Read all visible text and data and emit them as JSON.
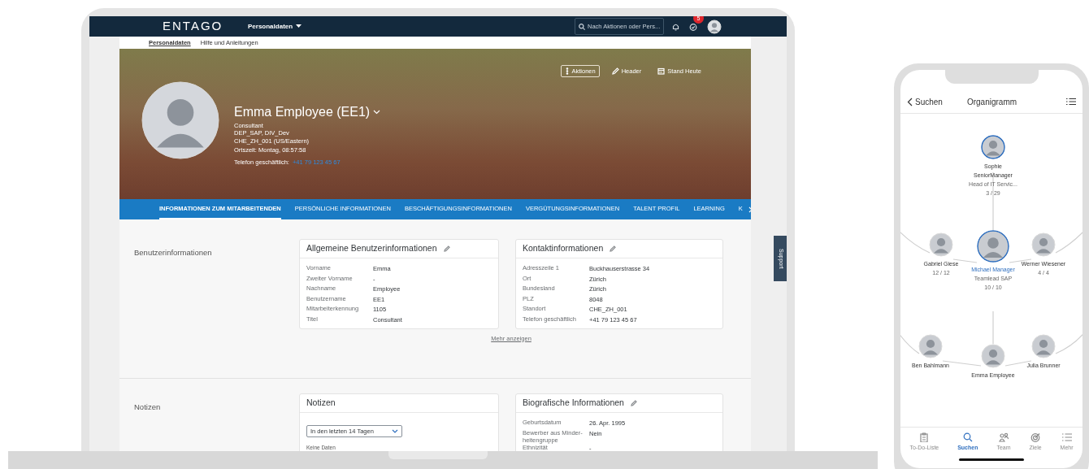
{
  "laptop": {
    "shell": {
      "logo": "ENTAGO",
      "app_menu": "Personaldaten",
      "search_placeholder": "Nach Aktionen oder Pers...",
      "notification_count": "5"
    },
    "subnav": [
      {
        "label": "Personaldaten",
        "selected": true
      },
      {
        "label": "Hilfe und Anleitungen",
        "selected": false
      }
    ],
    "profile": {
      "name": "Emma Employee (EE1)",
      "lines": [
        "Consultant",
        "DEP_SAP, DIV_Dev",
        "CHE_ZH_001 (US/Eastern)"
      ],
      "local_time": "Ortszeit: Montag, 08:57:58",
      "phone_label": "Telefon geschäftlich:",
      "phone": "+41 79 123 45 67"
    },
    "header_actions": [
      {
        "kind": "more",
        "label": "Aktionen"
      },
      {
        "kind": "edit",
        "label": "Header"
      },
      {
        "kind": "calendar",
        "label": "Stand Heute"
      }
    ],
    "tabs": [
      {
        "label": "INFORMATIONEN ZUM MITARBEITENDEN",
        "selected": true
      },
      {
        "label": "PERSÖNLICHE INFORMATIONEN",
        "selected": false
      },
      {
        "label": "BESCHÄFTIGUNGSINFORMATIONEN",
        "selected": false
      },
      {
        "label": "VERGÜTUNGSINFORMATIONEN",
        "selected": false
      },
      {
        "label": "TALENT PROFIL",
        "selected": false
      },
      {
        "label": "LEARNING",
        "selected": false
      },
      {
        "label": "K",
        "selected": false
      }
    ],
    "sections": [
      {
        "title": "Benutzerinformationen",
        "more_link": "Mehr anzeigen",
        "cards": [
          {
            "title": "Allgemeine Benutzerinformationen",
            "editable": true,
            "rows": [
              {
                "label": "Vorname",
                "value": "Emma"
              },
              {
                "label": "Zweiter Vorname",
                "value": "-"
              },
              {
                "label": "Nachname",
                "value": "Employee"
              },
              {
                "label": "Benutzername",
                "value": "EE1"
              },
              {
                "label": "Mitarbeiterkennung",
                "value": "1105"
              },
              {
                "label": "Titel",
                "value": "Consultant"
              }
            ]
          },
          {
            "title": "Kontaktinformationen",
            "editable": true,
            "rows": [
              {
                "label": "Adresszeile 1",
                "value": "Buckhauserstrasse 34"
              },
              {
                "label": "Ort",
                "value": "Zürich"
              },
              {
                "label": "Bundesland",
                "value": "Zürich"
              },
              {
                "label": "PLZ",
                "value": "8048"
              },
              {
                "label": "Standort",
                "value": "CHE_ZH_001"
              },
              {
                "label": "Telefon geschäftlich",
                "value": "+41 79 123 45 67"
              }
            ]
          }
        ]
      },
      {
        "title": "Notizen",
        "cards": [
          {
            "title": "Notizen",
            "editable": false,
            "filter": "In den letzten 14 Tagen",
            "empty_text": "Keine Daten"
          },
          {
            "title": "Biografische Informationen",
            "editable": true,
            "rows": [
              {
                "label": "Geburtsdatum",
                "value": "26. Apr. 1995"
              },
              {
                "label": "Bewerber aus Minder-heitengruppe",
                "value": "Nein"
              },
              {
                "label": "Ethnizität",
                "value": "-"
              }
            ]
          }
        ]
      }
    ],
    "support_tab": "Support"
  },
  "phone": {
    "back_label": "Suchen",
    "title": "Organigramm",
    "nodes": [
      {
        "name": "Sophie SeniorManager",
        "title": "Head of IT Servic...",
        "count": "3 / 29",
        "selected": false,
        "ring": true
      },
      {
        "name": "Gabriel Giese",
        "count": "12 / 12",
        "selected": false,
        "ring": false
      },
      {
        "name": "Michael Manager",
        "title": "Teamlead SAP",
        "count": "10 / 10",
        "selected": true,
        "ring": true
      },
      {
        "name": "Werner Wiesener",
        "count": "4 / 4",
        "selected": false,
        "ring": false
      },
      {
        "name": "Ben Bahlmann",
        "selected": false,
        "ring": false
      },
      {
        "name": "Emma Employee",
        "selected": false,
        "ring": false
      },
      {
        "name": "Julia Brunner",
        "selected": false,
        "ring": false
      }
    ],
    "tabbar": [
      {
        "kind": "todo",
        "label": "To-Do-Liste",
        "selected": false
      },
      {
        "kind": "search",
        "label": "Suchen",
        "selected": true
      },
      {
        "kind": "team",
        "label": "Team",
        "selected": false
      },
      {
        "kind": "goals",
        "label": "Ziele",
        "selected": false
      },
      {
        "kind": "more",
        "label": "Mehr",
        "selected": false
      }
    ]
  }
}
